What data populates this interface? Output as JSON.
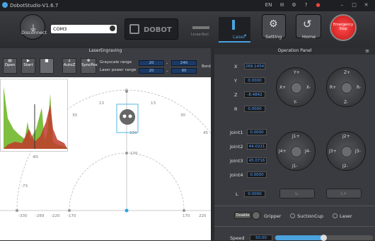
{
  "app": {
    "title": "DobotStudio-V1.6.7",
    "lang": "EN",
    "menu_icons": [
      "mail-icon",
      "settings-icon",
      "help-icon",
      "minimize-icon",
      "maximize-icon",
      "close-icon"
    ]
  },
  "toolbar": {
    "disconnect": "Disconnect",
    "port": "COM3",
    "brand": "DOBOT",
    "laser_label": "Laser",
    "setting": "Setting",
    "home": "Home",
    "estop": "Emergency Stop",
    "linear_rail": "LinearRail"
  },
  "left": {
    "title": "LaserEngraving",
    "tools": [
      "Open",
      "Start",
      "",
      "AutoZ",
      "SyncPos"
    ],
    "grayscale_label": "Grayscale  range",
    "grayscale_min": "20",
    "grayscale_max": "240",
    "laser_label": "Laser power range",
    "laser_min": "20",
    "laser_max": "90",
    "border_label": "Bord"
  },
  "plot": {
    "x_ticks": [
      "-330",
      "-269",
      "-220",
      "-170",
      "170",
      "220"
    ],
    "arc_labels": [
      "0",
      "13",
      "30",
      "45",
      "30",
      "13",
      "0",
      "170",
      "220",
      "-73",
      "-80"
    ]
  },
  "right": {
    "title": "Operation Panel",
    "coords": [
      {
        "label": "X",
        "value": "269.1454"
      },
      {
        "label": "Y",
        "value": "0.0000"
      },
      {
        "label": "Z",
        "value": "-8.4842"
      },
      {
        "label": "R",
        "value": "0.0000"
      }
    ],
    "joints": [
      {
        "label": "Joint1",
        "value": "0.0000"
      },
      {
        "label": "Joint2",
        "value": "44.0221"
      },
      {
        "label": "Joint3",
        "value": "45.0716"
      },
      {
        "label": "Joint4",
        "value": "0.0000"
      }
    ],
    "l_label": "L",
    "l_value": "0.0000",
    "l_minus": "L-",
    "l_plus": "L+",
    "mode": "Doable",
    "gripper": "Gripper",
    "suction": "SuctionCup",
    "laser": "Laser",
    "speed_label": "Speed",
    "speed_value": "50.00"
  }
}
